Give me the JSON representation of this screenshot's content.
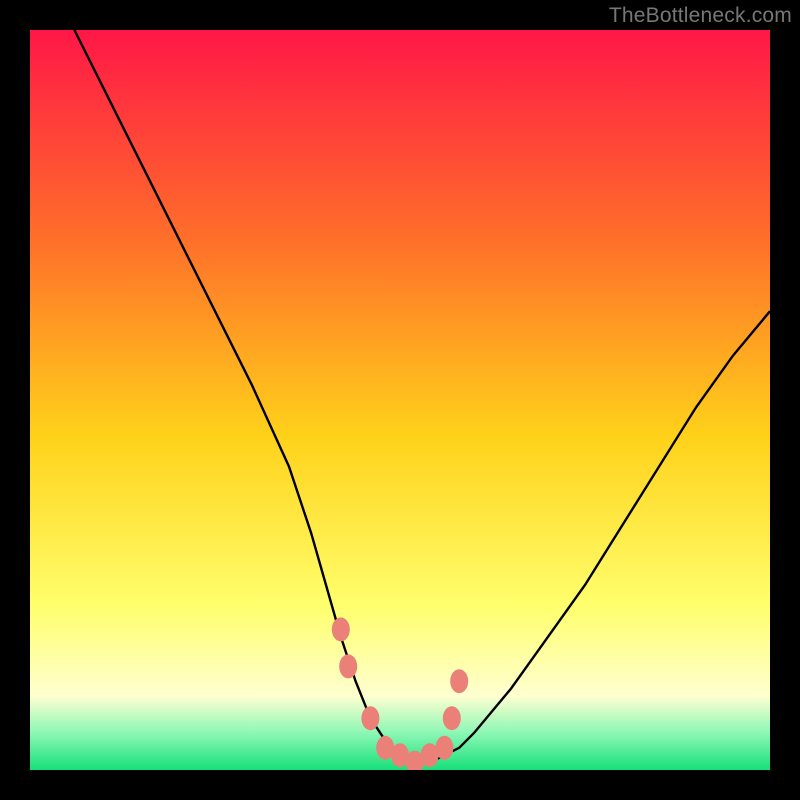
{
  "watermark": "TheBottleneck.com",
  "colors": {
    "top": "#ff1747",
    "upper": "#ff6e2a",
    "mid": "#ffd21a",
    "lower": "#ffff6e",
    "pale": "#ffffd0",
    "mint": "#8cf7b5",
    "green": "#17e07a",
    "curve": "#000000",
    "marker": "#ea8078",
    "wm": "#777777"
  },
  "chart_data": {
    "type": "line",
    "title": "",
    "xlabel": "",
    "ylabel": "",
    "xlim": [
      0,
      100
    ],
    "ylim": [
      0,
      100
    ],
    "series": [
      {
        "name": "bottleneck-curve",
        "x": [
          6,
          10,
          15,
          20,
          25,
          30,
          35,
          38,
          40,
          42,
          44,
          46,
          48,
          50,
          52,
          54,
          56,
          58,
          60,
          65,
          70,
          75,
          80,
          85,
          90,
          95,
          100
        ],
        "values": [
          100,
          92,
          82,
          72,
          62,
          52,
          41,
          32,
          25,
          18,
          12,
          7,
          4,
          2,
          1,
          1,
          2,
          3,
          5,
          11,
          18,
          25,
          33,
          41,
          49,
          56,
          62
        ]
      }
    ],
    "markers": {
      "name": "highlighted-points",
      "x": [
        42,
        43,
        46,
        48,
        50,
        52,
        54,
        56,
        57,
        58
      ],
      "values": [
        19,
        14,
        7,
        3,
        2,
        1,
        2,
        3,
        7,
        12
      ]
    }
  }
}
